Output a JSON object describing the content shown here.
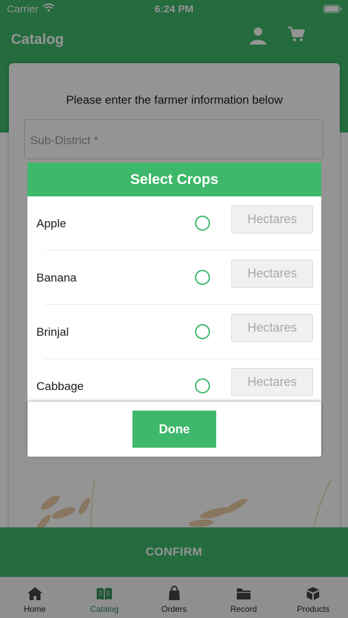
{
  "status_bar": {
    "carrier": "Carrier",
    "time": "6:24 PM"
  },
  "header": {
    "title": "Catalog",
    "icons": [
      "user-icon",
      "cart-icon"
    ]
  },
  "form": {
    "prompt": "Please enter the farmer information below",
    "subdistrict_placeholder": "Sub-District *"
  },
  "dialog": {
    "title": "Select Crops",
    "crops": [
      {
        "name": "Apple",
        "hectares_placeholder": "Hectares",
        "selected": false
      },
      {
        "name": "Banana",
        "hectares_placeholder": "Hectares",
        "selected": false
      },
      {
        "name": "Brinjal",
        "hectares_placeholder": "Hectares",
        "selected": false
      },
      {
        "name": "Cabbage",
        "hectares_placeholder": "Hectares",
        "selected": false
      }
    ],
    "done_label": "Done"
  },
  "confirm_label": "CONFIRM",
  "tabs": [
    {
      "label": "Home",
      "icon": "home-icon"
    },
    {
      "label": "Catalog",
      "icon": "catalog-icon",
      "active": true
    },
    {
      "label": "Orders",
      "icon": "orders-icon"
    },
    {
      "label": "Record",
      "icon": "record-icon"
    },
    {
      "label": "Products",
      "icon": "products-icon"
    }
  ],
  "colors": {
    "brand_green": "#3eb86a",
    "active_tab": "#2e8b57"
  }
}
